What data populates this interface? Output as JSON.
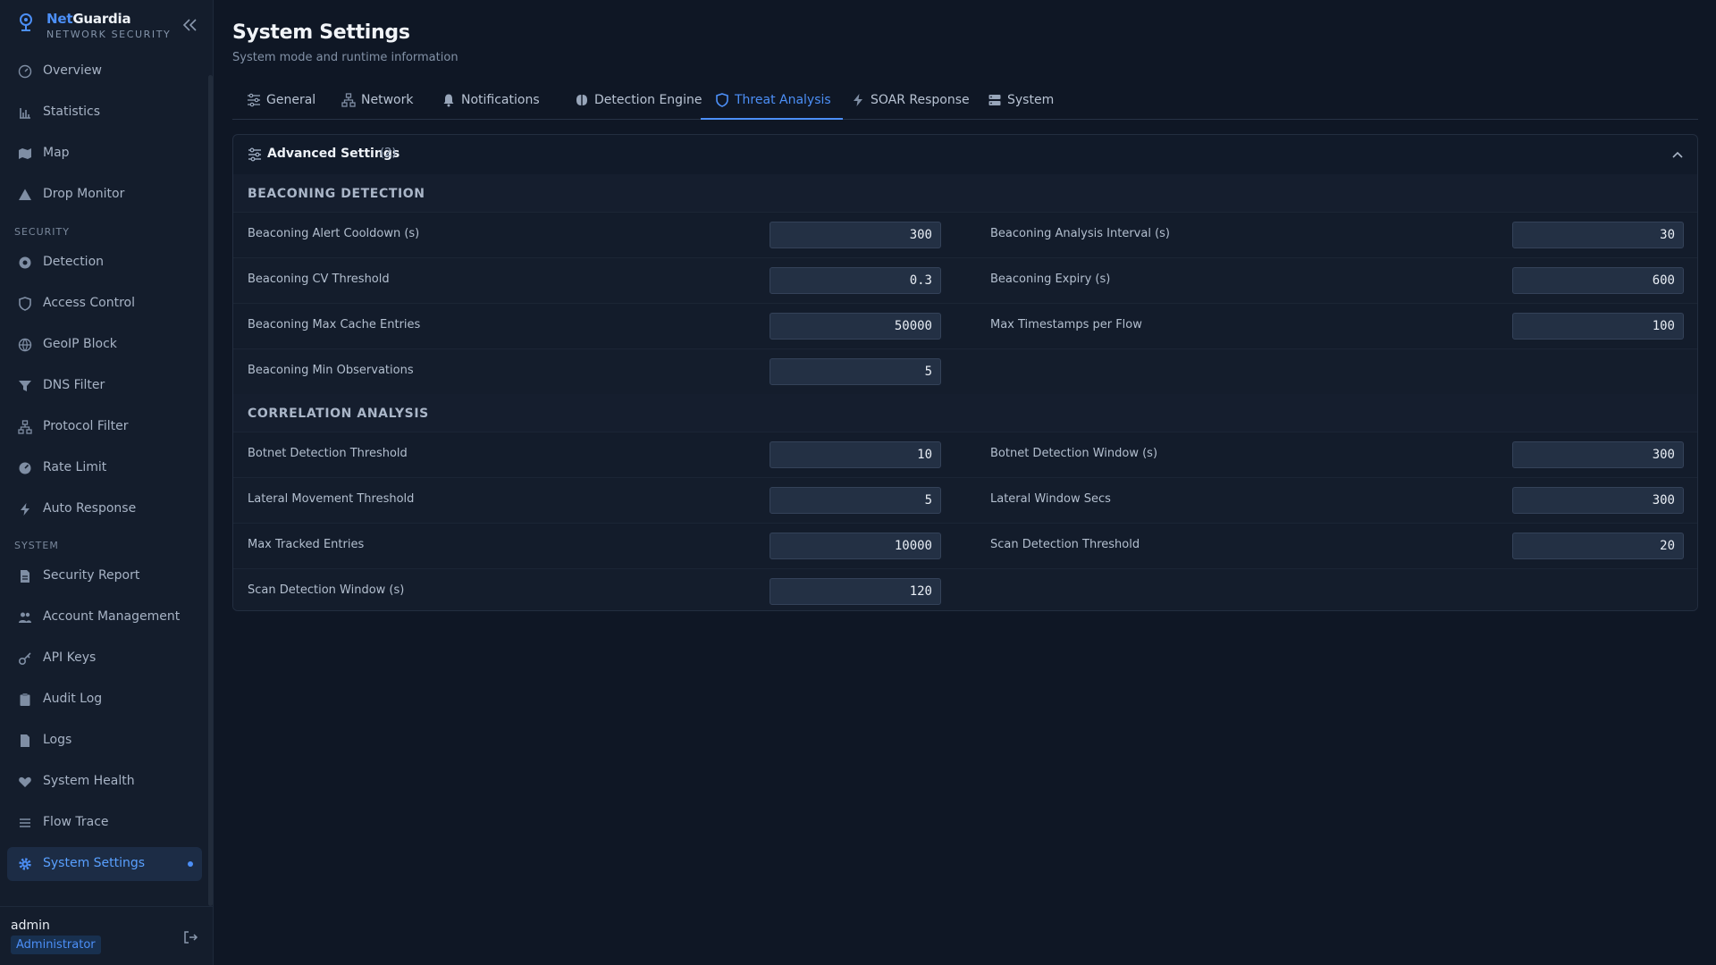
{
  "brand": {
    "name_prefix": "Net",
    "name_suffix": "Guardia",
    "subtitle": "NETWORK SECURITY"
  },
  "sidebar": {
    "items_top": [
      {
        "label": "Overview",
        "icon": "gauge-icon"
      },
      {
        "label": "Statistics",
        "icon": "bar-chart-icon"
      },
      {
        "label": "Map",
        "icon": "map-icon"
      },
      {
        "label": "Drop Monitor",
        "icon": "warning-triangle-icon"
      }
    ],
    "security_title": "SECURITY",
    "items_security": [
      {
        "label": "Detection",
        "icon": "radar-icon"
      },
      {
        "label": "Access Control",
        "icon": "shield-icon"
      },
      {
        "label": "GeoIP Block",
        "icon": "globe-icon"
      },
      {
        "label": "DNS Filter",
        "icon": "filter-icon"
      },
      {
        "label": "Protocol Filter",
        "icon": "network-icon"
      },
      {
        "label": "Rate Limit",
        "icon": "speedometer-icon"
      },
      {
        "label": "Auto Response",
        "icon": "bolt-icon"
      }
    ],
    "system_title": "SYSTEM",
    "items_system": [
      {
        "label": "Security Report",
        "icon": "document-icon"
      },
      {
        "label": "Account Management",
        "icon": "users-icon"
      },
      {
        "label": "API Keys",
        "icon": "key-icon"
      },
      {
        "label": "Audit Log",
        "icon": "clipboard-icon"
      },
      {
        "label": "Logs",
        "icon": "file-icon"
      },
      {
        "label": "System Health",
        "icon": "heart-pulse-icon"
      },
      {
        "label": "Flow Trace",
        "icon": "list-icon"
      },
      {
        "label": "System Settings",
        "icon": "gear-icon",
        "active": true
      }
    ]
  },
  "user": {
    "name": "admin",
    "role": "Administrator"
  },
  "header": {
    "title": "System Settings",
    "subtitle": "System mode and runtime information"
  },
  "tabs": [
    {
      "label": "General",
      "icon": "sliders-icon"
    },
    {
      "label": "Network",
      "icon": "network-icon"
    },
    {
      "label": "Notifications",
      "icon": "bell-icon"
    },
    {
      "label": "Detection Engine",
      "icon": "brain-icon"
    },
    {
      "label": "Threat Analysis",
      "icon": "shield-icon",
      "active": true
    },
    {
      "label": "SOAR Response",
      "icon": "bolt-icon"
    },
    {
      "label": "System",
      "icon": "server-icon"
    }
  ],
  "panel": {
    "title": "Advanced Settings",
    "count": "(2)",
    "beaconing": {
      "title": "BEACONING DETECTION",
      "rows": [
        {
          "left_label": "Beaconing Alert Cooldown (s)",
          "left_value": "300",
          "right_label": "Beaconing Analysis Interval (s)",
          "right_value": "30"
        },
        {
          "left_label": "Beaconing CV Threshold",
          "left_value": "0.3",
          "right_label": "Beaconing Expiry (s)",
          "right_value": "600"
        },
        {
          "left_label": "Beaconing Max Cache Entries",
          "left_value": "50000",
          "right_label": "Max Timestamps per Flow",
          "right_value": "100"
        },
        {
          "left_label": "Beaconing Min Observations",
          "left_value": "5"
        }
      ]
    },
    "correlation": {
      "title": "CORRELATION ANALYSIS",
      "rows": [
        {
          "left_label": "Botnet Detection Threshold",
          "left_value": "10",
          "right_label": "Botnet Detection Window (s)",
          "right_value": "300"
        },
        {
          "left_label": "Lateral Movement Threshold",
          "left_value": "5",
          "right_label": "Lateral Window Secs",
          "right_value": "300"
        },
        {
          "left_label": "Max Tracked Entries",
          "left_value": "10000",
          "right_label": "Scan Detection Threshold",
          "right_value": "20"
        },
        {
          "left_label": "Scan Detection Window (s)",
          "left_value": "120"
        }
      ]
    }
  }
}
